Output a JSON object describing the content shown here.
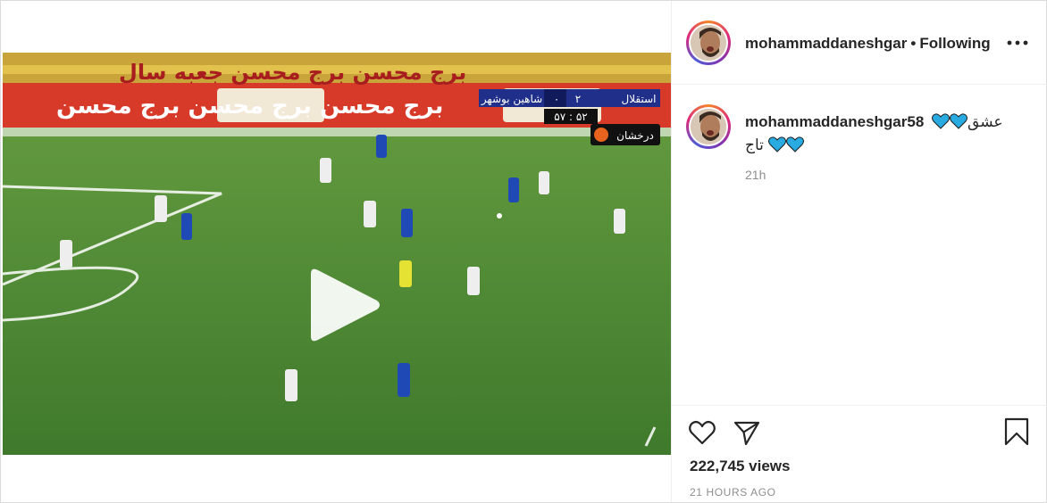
{
  "post": {
    "username": "mohammaddaneshgar",
    "separator": "•",
    "follow_status": "Following",
    "caption_user": "mohammaddaneshgar58",
    "caption_text_line1": "عشق",
    "caption_text_line2": "تاج",
    "comment_age": "21h",
    "views": "222,745 views",
    "posted_ago": "21 HOURS AGO"
  },
  "scoreboard": {
    "team_home": "استقلال",
    "team_away": "شاهین بوشهر",
    "score_home": "۲",
    "score_away": "۰",
    "clock": "۵۷ : ۵۲",
    "broadcaster": "درخشان"
  },
  "banners": {
    "top_row": "برج محسن     برج محسن     جعبه سال",
    "bottom_row": "برج محسن     برج محسن     برج محسن"
  },
  "icons": {
    "play": "play-icon",
    "more": "more-horizontal-icon",
    "like": "heart-outline-icon",
    "share": "send-icon",
    "save": "bookmark-outline-icon",
    "heart_emoji": "blue-heart-icon"
  },
  "colors": {
    "heart_blue": "#29abe2",
    "pitch_green": "#4f8a35",
    "meta_gray": "#8e8e8e"
  }
}
